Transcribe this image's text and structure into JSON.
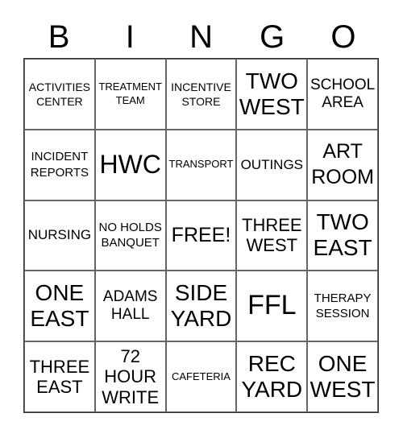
{
  "header": {
    "letters": [
      "B",
      "I",
      "N",
      "G",
      "O"
    ]
  },
  "cells": [
    [
      "ACTIVITIES CENTER",
      "TREATMENT TEAM",
      "INCENTIVE STORE",
      "TWO WEST",
      "SCHOOL AREA"
    ],
    [
      "INCIDENT REPORTS",
      "HWC",
      "TRANSPORT",
      "OUTINGS",
      "ART ROOM"
    ],
    [
      "NURSING",
      "NO HOLDS BANQUET",
      "FREE!",
      "THREE WEST",
      "TWO EAST"
    ],
    [
      "ONE EAST",
      "ADAMS HALL",
      "SIDE YARD",
      "FFL",
      "THERAPY SESSION"
    ],
    [
      "THREE EAST",
      "72 HOUR WRITE",
      "CAFETERIA",
      "REC YARD",
      "ONE WEST"
    ]
  ],
  "colors": {
    "border": "#666666",
    "text": "#000000",
    "background": "#ffffff"
  }
}
